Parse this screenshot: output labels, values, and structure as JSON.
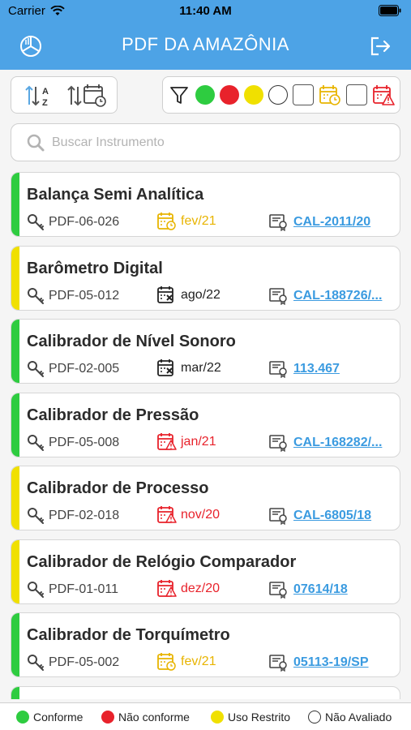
{
  "status_bar": {
    "carrier": "Carrier",
    "time": "11:40 AM"
  },
  "header": {
    "title": "PDF DA AMAZÔNIA",
    "left_icon": "chart-logo-icon",
    "right_icon": "logout-icon"
  },
  "sort": {
    "alpha_icon": "sort-alpha-icon",
    "date_icon": "sort-date-icon"
  },
  "filters": [
    {
      "name": "funnel-icon",
      "type": "icon"
    },
    {
      "name": "filter-green",
      "color": "#2ecc40"
    },
    {
      "name": "filter-red",
      "color": "#e8222b"
    },
    {
      "name": "filter-yellow",
      "color": "#f0e000"
    },
    {
      "name": "filter-white",
      "color": "#ffffff"
    },
    {
      "name": "filter-empty-1",
      "type": "square"
    },
    {
      "name": "calendar-clock-icon",
      "type": "icon"
    },
    {
      "name": "filter-empty-2",
      "type": "square"
    },
    {
      "name": "calendar-alert-icon",
      "type": "icon"
    }
  ],
  "search": {
    "placeholder": "Buscar Instrumento"
  },
  "items": [
    {
      "name": "Balança Semi Analítica",
      "code": "PDF-06-026",
      "date": "fev/21",
      "date_status": "pending",
      "cert": "CAL-2011/20",
      "status_color": "#2ecc40"
    },
    {
      "name": "Barômetro Digital",
      "code": "PDF-05-012",
      "date": "ago/22",
      "date_status": "ok",
      "cert": "CAL-188726/...",
      "status_color": "#f0e000"
    },
    {
      "name": "Calibrador de Nível Sonoro",
      "code": "PDF-02-005",
      "date": "mar/22",
      "date_status": "ok",
      "cert": "113.467",
      "status_color": "#2ecc40"
    },
    {
      "name": "Calibrador de Pressão",
      "code": "PDF-05-008",
      "date": "jan/21",
      "date_status": "expired",
      "cert": "CAL-168282/...",
      "status_color": "#2ecc40"
    },
    {
      "name": "Calibrador de Processo",
      "code": "PDF-02-018",
      "date": "nov/20",
      "date_status": "expired",
      "cert": "CAL-6805/18",
      "status_color": "#f0e000"
    },
    {
      "name": "Calibrador de Relógio Comparador",
      "code": "PDF-01-011",
      "date": "dez/20",
      "date_status": "expired",
      "cert": "07614/18",
      "status_color": "#f0e000"
    },
    {
      "name": "Calibrador de Torquímetro",
      "code": "PDF-05-002",
      "date": "fev/21",
      "date_status": "pending",
      "cert": "05113-19/SP",
      "status_color": "#2ecc40"
    }
  ],
  "legend": [
    {
      "label": "Conforme",
      "color": "#2ecc40"
    },
    {
      "label": "Não conforme",
      "color": "#e8222b"
    },
    {
      "label": "Uso Restrito",
      "color": "#f0e000"
    },
    {
      "label": "Não Avaliado",
      "color": "#ffffff"
    }
  ],
  "colors": {
    "accent": "#4da3e6",
    "link": "#3b9be0",
    "date_pending": "#e8b400",
    "date_expired": "#e8222b",
    "date_ok": "#222222"
  }
}
